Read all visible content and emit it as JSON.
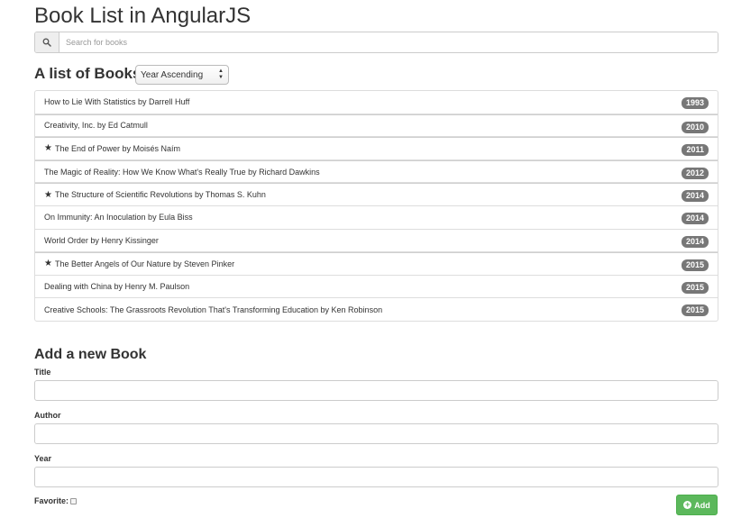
{
  "page": {
    "title": "Book List in AngularJS"
  },
  "search": {
    "placeholder": "Search for books",
    "icon": "search-icon"
  },
  "list": {
    "heading": "A list of Books",
    "sort_selected": "Year Ascending",
    "books": [
      {
        "text": "How to Lie With Statistics by Darrell Huff",
        "year": "1993",
        "favorite": false
      },
      {
        "text": "Creativity, Inc. by Ed Catmull",
        "year": "2010",
        "favorite": false
      },
      {
        "text": "The End of Power by Moisés Naím",
        "year": "2011",
        "favorite": true
      },
      {
        "text": "The Magic of Reality: How We Know What's Really True by Richard Dawkins",
        "year": "2012",
        "favorite": false
      },
      {
        "text": "The Structure of Scientific Revolutions by Thomas S. Kuhn",
        "year": "2014",
        "favorite": true
      },
      {
        "text": "On Immunity: An Inoculation by Eula Biss",
        "year": "2014",
        "favorite": false
      },
      {
        "text": "World Order by Henry Kissinger",
        "year": "2014",
        "favorite": false
      },
      {
        "text": "The Better Angels of Our Nature by Steven Pinker",
        "year": "2015",
        "favorite": true
      },
      {
        "text": "Dealing with China by Henry M. Paulson",
        "year": "2015",
        "favorite": false
      },
      {
        "text": "Creative Schools: The Grassroots Revolution That's Transforming Education by Ken Robinson",
        "year": "2015",
        "favorite": false
      }
    ]
  },
  "form": {
    "heading": "Add a new Book",
    "title_label": "Title",
    "title_value": "",
    "author_label": "Author",
    "author_value": "",
    "year_label": "Year",
    "year_value": "",
    "favorite_label": "Favorite:",
    "favorite_checked": false,
    "add_label": "Add"
  },
  "colors": {
    "badge": "#777777",
    "add_button": "#5cb85c"
  }
}
